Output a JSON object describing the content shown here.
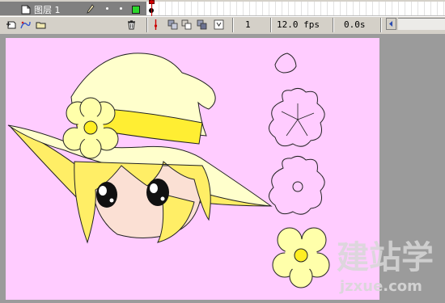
{
  "timeline": {
    "layer_name": "图层 1",
    "frame_number": "1",
    "fps": "12.0 fps",
    "elapsed_time": "0.0s"
  },
  "watermark": {
    "logo_text": "建站学",
    "url_text": "jzxue.com"
  },
  "colors": {
    "stage_background": "#ffccff",
    "hat_fill": "#ffffcc",
    "hat_band": "#ffee33",
    "hair_fill": "#ffee66",
    "skin_fill": "#fbe0d4",
    "flower_fill": "#ffffaa",
    "flower_center": "#ffee22",
    "timeline_playhead": "#cc0000"
  },
  "icons": [
    "page-icon",
    "pencil-icon",
    "outline-square-icon",
    "insert-layer-icon",
    "motion-guide-icon",
    "insert-folder-icon",
    "trash-icon",
    "center-frame-icon",
    "onion-skin-icon",
    "onion-skin-outlines-icon",
    "edit-multiple-frames-icon",
    "onion-markers-icon",
    "scroll-left-icon"
  ]
}
